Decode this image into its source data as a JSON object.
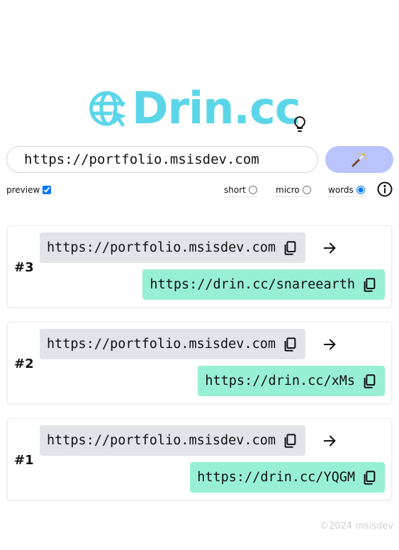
{
  "brand": {
    "logo_text": "Drin.cc",
    "logo_color": "#5bd6e8"
  },
  "input": {
    "value": "https://portfolio.msisdev.com"
  },
  "options": {
    "preview": {
      "label": "preview",
      "checked": true
    },
    "modes": [
      {
        "label": "short",
        "selected": false
      },
      {
        "label": "micro",
        "selected": false
      },
      {
        "label": "words",
        "selected": true
      }
    ]
  },
  "results": [
    {
      "index": "#3",
      "long_url": "https://portfolio.msisdev.com",
      "short_url": "https://drin.cc/snareearth"
    },
    {
      "index": "#2",
      "long_url": "https://portfolio.msisdev.com",
      "short_url": "https://drin.cc/xMs"
    },
    {
      "index": "#1",
      "long_url": "https://portfolio.msisdev.com",
      "short_url": "https://drin.cc/YQGM"
    }
  ],
  "footer": {
    "text": "©2024 msisdev"
  },
  "colors": {
    "generate_button": "#b8c4fb",
    "long_pill": "#e2e4ea",
    "short_pill": "#98f0d4"
  },
  "icons": [
    "globe-cursor-icon",
    "lightbulb-icon",
    "magic-wand-icon",
    "info-icon",
    "copy-icon",
    "arrow-right-icon"
  ]
}
